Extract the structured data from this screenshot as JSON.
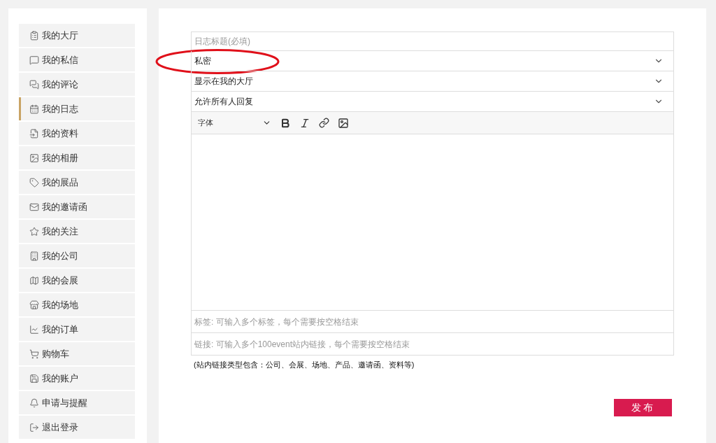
{
  "sidebar": {
    "items": [
      {
        "label": "我的大厅",
        "selected": false
      },
      {
        "label": "我的私信",
        "selected": false
      },
      {
        "label": "我的评论",
        "selected": false
      },
      {
        "label": "我的日志",
        "selected": true
      },
      {
        "label": "我的资料",
        "selected": false
      },
      {
        "label": "我的相册",
        "selected": false
      },
      {
        "label": "我的展品",
        "selected": false
      },
      {
        "label": "我的邀请函",
        "selected": false
      },
      {
        "label": "我的关注",
        "selected": false
      },
      {
        "label": "我的公司",
        "selected": false
      },
      {
        "label": "我的会展",
        "selected": false
      },
      {
        "label": "我的场地",
        "selected": false
      },
      {
        "label": "我的订单",
        "selected": false
      },
      {
        "label": "购物车",
        "selected": false
      },
      {
        "label": "我的账户",
        "selected": false
      },
      {
        "label": "申请与提醒",
        "selected": false
      },
      {
        "label": "退出登录",
        "selected": false
      }
    ]
  },
  "form": {
    "title_field": {
      "placeholder": "日志标题(必填)"
    },
    "selects": [
      {
        "value": "私密",
        "highlighted": true
      },
      {
        "value": "显示在我的大厅",
        "highlighted": false
      },
      {
        "value": "允许所有人回复",
        "highlighted": false
      }
    ],
    "editor": {
      "font_select": "字体"
    },
    "tags_field": {
      "placeholder": "标签: 可输入多个标签，每个需要按空格结束"
    },
    "links_field": {
      "placeholder": "链接: 可输入多个100event站内链接，每个需要按空格结束"
    },
    "note": "(站内链接类型包含：公司、会展、场地、产品、邀请函、资料等)",
    "submit": "发布"
  }
}
